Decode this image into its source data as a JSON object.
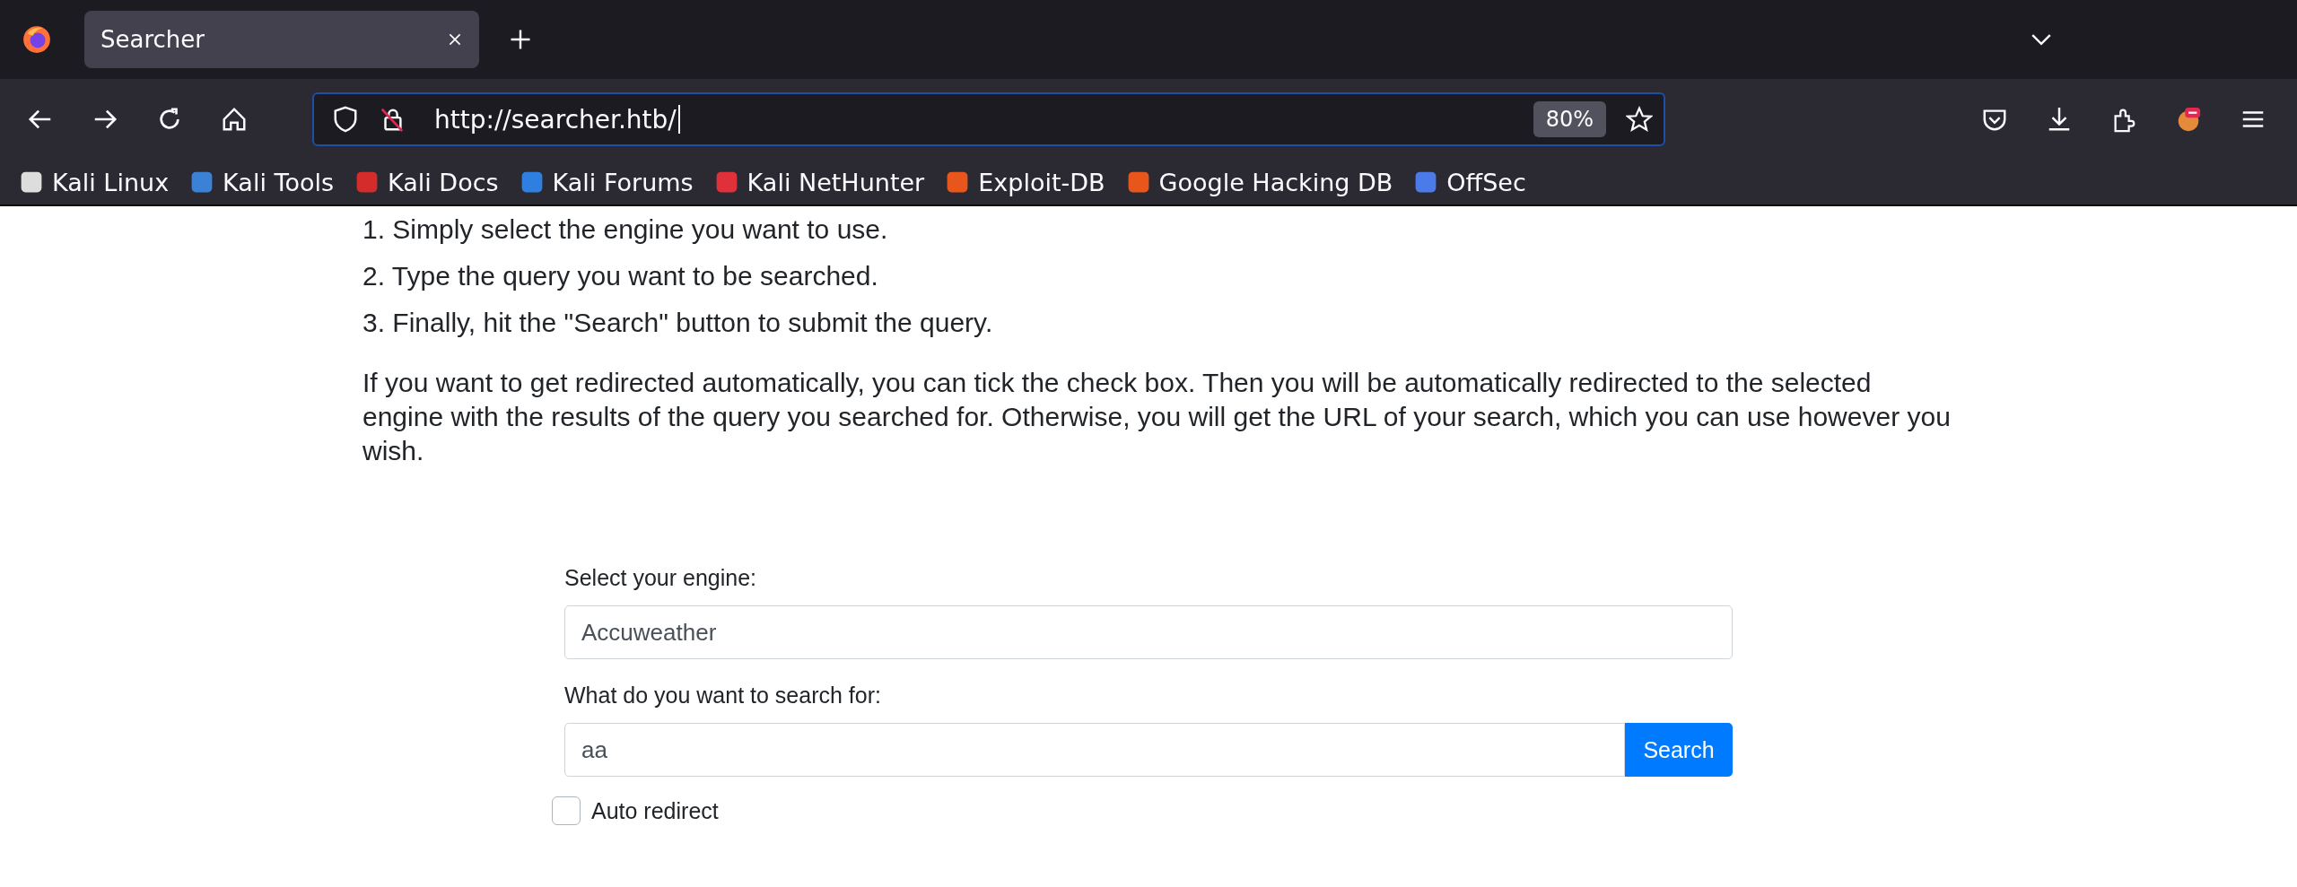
{
  "browser": {
    "tab": {
      "title": "Searcher",
      "selected": true
    },
    "url": "http://searcher.htb/",
    "zoom": "80%",
    "bookmarks": [
      {
        "label": "Kali Linux",
        "color": "#dddddd"
      },
      {
        "label": "Kali Tools",
        "color": "#3b82d6"
      },
      {
        "label": "Kali Docs",
        "color": "#d42b2b"
      },
      {
        "label": "Kali Forums",
        "color": "#2f7fe0"
      },
      {
        "label": "Kali NetHunter",
        "color": "#e0303a"
      },
      {
        "label": "Exploit-DB",
        "color": "#e8561c"
      },
      {
        "label": "Google Hacking DB",
        "color": "#e8561c"
      },
      {
        "label": "OffSec",
        "color": "#4a7be8"
      }
    ]
  },
  "page": {
    "steps": [
      "1. Simply select the engine you want to use.",
      "2. Type the query you want to be searched.",
      "3. Finally, hit the \"Search\" button to submit the query."
    ],
    "paragraph": "If you want to get redirected automatically, you can tick the check box. Then you will be automatically redirected to the selected engine with the results of the query you searched for. Otherwise, you will get the URL of your search, which you can use however you wish.",
    "form": {
      "engine_label": "Select your engine:",
      "engine_value": "Accuweather",
      "query_label": "What do you want to search for:",
      "query_value": "aa",
      "search_button": "Search",
      "auto_redirect": {
        "label": "Auto redirect",
        "checked": false
      }
    }
  }
}
